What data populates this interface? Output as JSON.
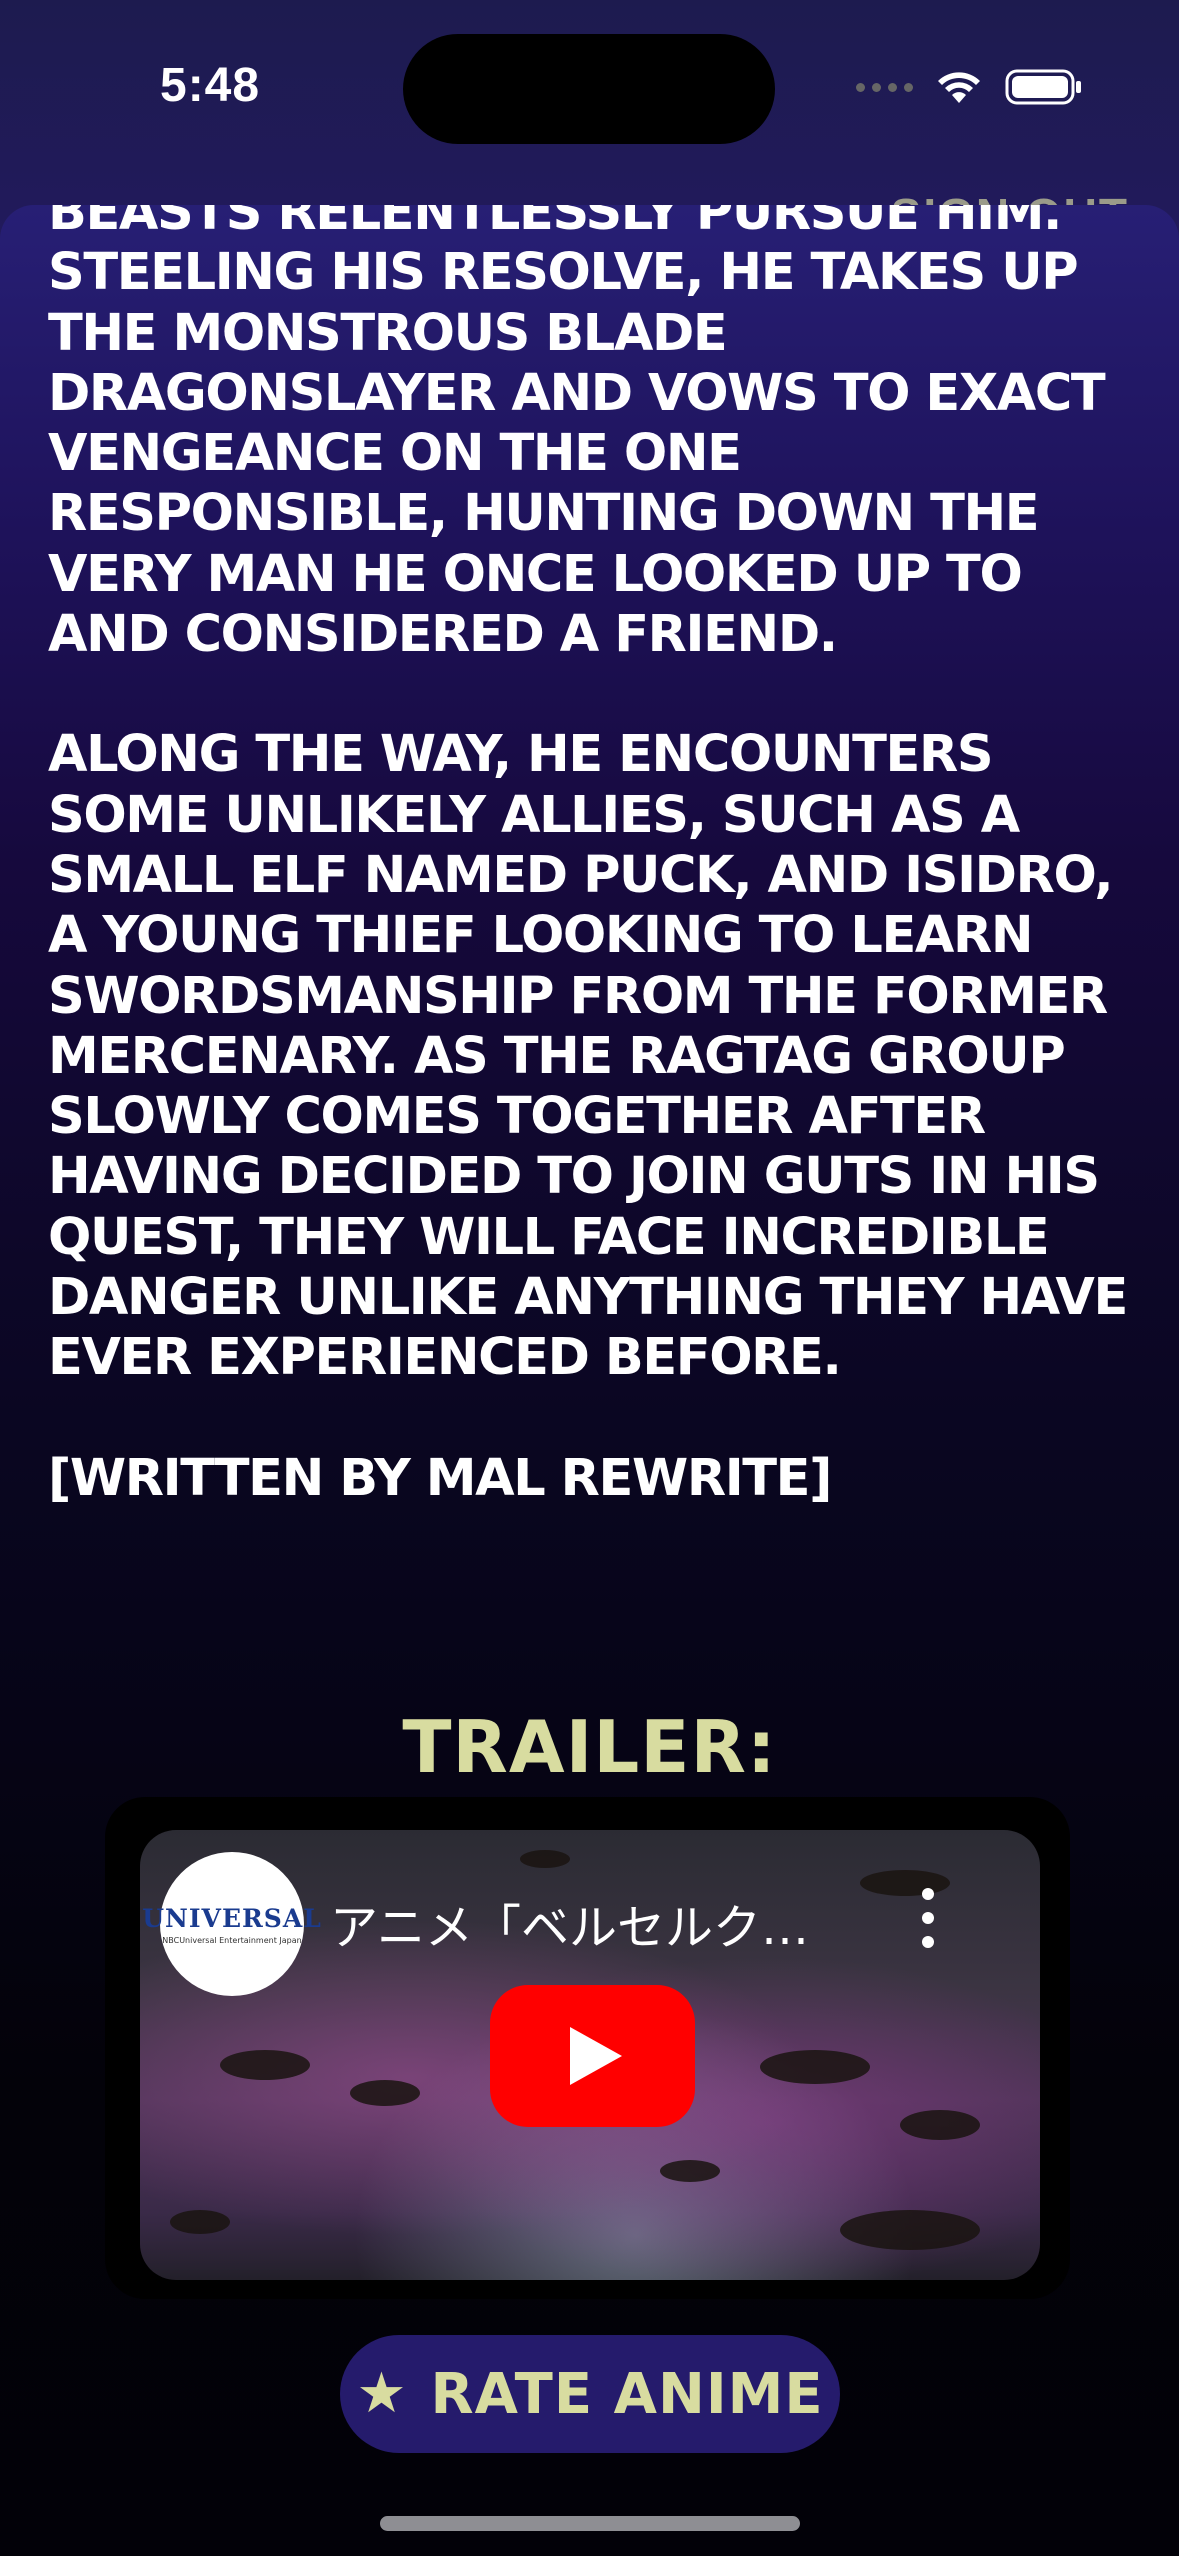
{
  "status_bar": {
    "time": "5:48"
  },
  "header": {
    "sign_out_label": "SIGN OUT"
  },
  "synopsis": {
    "paragraphs": [
      [
        "BEASTS RELENTLESSLY PURSUE HIM.",
        "STEELING HIS RESOLVE, HE TAKES UP",
        "THE MONSTROUS BLADE",
        "DRAGONSLAYER AND VOWS TO EXACT",
        "VENGEANCE ON THE ONE",
        "RESPONSIBLE, HUNTING DOWN THE",
        "VERY MAN HE ONCE LOOKED UP TO",
        "AND CONSIDERED A FRIEND."
      ],
      [
        "ALONG THE WAY, HE ENCOUNTERS",
        "SOME UNLIKELY ALLIES, SUCH AS A",
        "SMALL ELF NAMED PUCK, AND ISIDRO,",
        "A YOUNG THIEF LOOKING TO LEARN",
        "SWORDSMANSHIP FROM THE FORMER",
        "MERCENARY. AS THE RAGTAG GROUP",
        "SLOWLY COMES TOGETHER AFTER",
        "HAVING DECIDED TO JOIN GUTS IN HIS",
        "QUEST, THEY WILL FACE INCREDIBLE",
        "DANGER UNLIKE ANYTHING THEY HAVE",
        "EVER EXPERIENCED BEFORE."
      ],
      [
        "[WRITTEN BY MAL REWRITE]"
      ]
    ]
  },
  "trailer": {
    "heading": "TRAILER:",
    "channel_logo_text": "UNIVERSAL",
    "channel_logo_subtext": "NBCUniversal Entertainment Japan",
    "video_title": "アニメ「ベルセルク…"
  },
  "actions": {
    "rate_label": "RATE ANIME",
    "rate_icon": "star-icon"
  }
}
